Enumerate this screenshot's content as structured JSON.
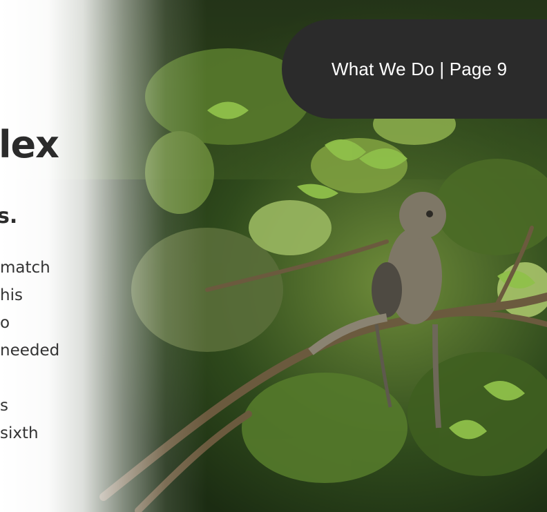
{
  "page_label": "What We Do | Page 9",
  "heading_fragment": "lex",
  "subheading_fragment": "s.",
  "body_fragments": [
    "match",
    "his",
    "o",
    "needed",
    "",
    "s",
    " sixth"
  ],
  "colors": {
    "badge_background": "#2b2b2b",
    "badge_text": "#ffffff",
    "text": "#2b2b2b"
  }
}
